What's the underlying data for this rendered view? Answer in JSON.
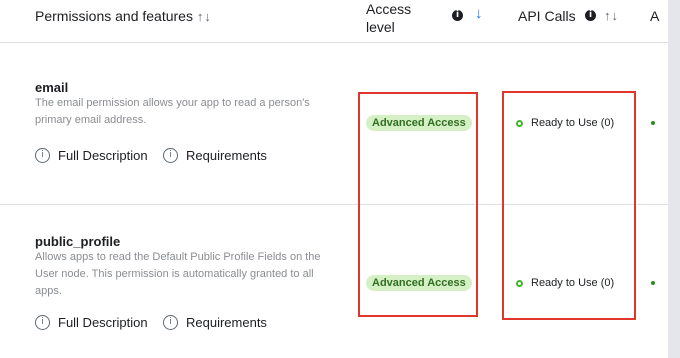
{
  "header": {
    "permissions_label": "Permissions and features",
    "sort_glyph": "↑↓",
    "access_level_line1": "Access",
    "access_level_line2": "level",
    "access_sort_glyph": "↓",
    "api_calls_label": "API Calls",
    "api_sort_glyph": "↑↓",
    "truncated_label": "A"
  },
  "permissions": [
    {
      "name": "email",
      "description_lines": [
        "The email permission allows your app to read a person's",
        "primary email address."
      ],
      "full_description_label": "Full Description",
      "requirements_label": "Requirements",
      "access_badge": "Advanced Access",
      "api_status": "Ready to Use (0)"
    },
    {
      "name": "public_profile",
      "description_lines": [
        "Allows apps to read the Default Public Profile Fields on the",
        "User node. This permission is automatically granted to all",
        "apps."
      ],
      "full_description_label": "Full Description",
      "requirements_label": "Requirements",
      "access_badge": "Advanced Access",
      "api_status": "Ready to Use (0)"
    }
  ],
  "icons": {
    "info": "i",
    "info_outline": "i"
  },
  "colors": {
    "badge_bg": "#d6f0c6",
    "badge_text": "#2f6f21",
    "ready_ring": "#42b72a",
    "highlight_box": "#e0352b",
    "sort_active": "#1877f2"
  }
}
